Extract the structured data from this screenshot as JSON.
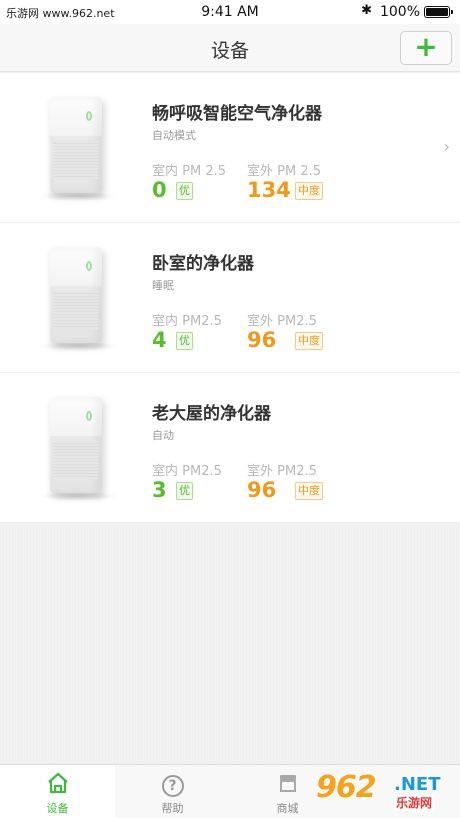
{
  "status_bar": {
    "carrier": "乐游网 www.962.net",
    "time": "9:41 AM",
    "bluetooth": "✱",
    "battery_pct": "100%"
  },
  "nav": {
    "title": "设备",
    "add_label": "+"
  },
  "devices": [
    {
      "name": "畅呼吸智能空气净化器",
      "mode": "自动模式",
      "indoor_label": "室内 PM 2.5",
      "outdoor_label": "室外 PM 2.5",
      "indoor_value": "0",
      "indoor_quality": "优",
      "outdoor_value": "134",
      "outdoor_quality": "中度",
      "chevron": "›"
    },
    {
      "name": "卧室的净化器",
      "mode": "睡眠",
      "indoor_label": "室内 PM2.5",
      "outdoor_label": "室外 PM2.5",
      "indoor_value": "4",
      "indoor_quality": "优",
      "outdoor_value": "96",
      "outdoor_quality": "中度"
    },
    {
      "name": "老大屋的净化器",
      "mode": "自动",
      "indoor_label": "室内 PM2.5",
      "outdoor_label": "室外 PM2.5",
      "indoor_value": "3",
      "indoor_quality": "优",
      "outdoor_value": "96",
      "outdoor_quality": "中度"
    }
  ],
  "tabs": [
    {
      "label": "设备",
      "icon": "home-icon",
      "active": true
    },
    {
      "label": "帮助",
      "icon": "help-icon",
      "active": false
    },
    {
      "label": "商城",
      "icon": "store-icon",
      "active": false
    },
    {
      "label": "",
      "icon": "profile-icon",
      "active": false
    }
  ],
  "watermark": {
    "logo": "962",
    "net": ".NET",
    "site": "乐游网"
  },
  "colors": {
    "accent_green": "#3dbb3a",
    "good_green": "#55bf2c",
    "moderate_orange": "#ef9a1a"
  }
}
